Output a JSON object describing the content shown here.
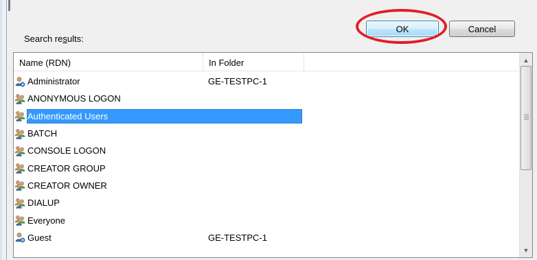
{
  "buttons": {
    "ok_label": "OK",
    "cancel_label": "Cancel"
  },
  "search_label_parts": [
    "Search re",
    "s",
    "ults:"
  ],
  "columns": {
    "name": "Name (RDN)",
    "folder": "In Folder"
  },
  "rows": [
    {
      "name": "Administrator",
      "folder": "GE-TESTPC-1",
      "icon": "user-icon"
    },
    {
      "name": "ANONYMOUS LOGON",
      "folder": "",
      "icon": "group-icon"
    },
    {
      "name": "Authenticated Users",
      "folder": "",
      "icon": "group-icon",
      "selected": true
    },
    {
      "name": "BATCH",
      "folder": "",
      "icon": "group-icon"
    },
    {
      "name": "CONSOLE LOGON",
      "folder": "",
      "icon": "group-icon"
    },
    {
      "name": "CREATOR GROUP",
      "folder": "",
      "icon": "group-icon"
    },
    {
      "name": "CREATOR OWNER",
      "folder": "",
      "icon": "group-icon"
    },
    {
      "name": "DIALUP",
      "folder": "",
      "icon": "group-icon"
    },
    {
      "name": "Everyone",
      "folder": "",
      "icon": "group-icon"
    },
    {
      "name": "Guest",
      "folder": "GE-TESTPC-1",
      "icon": "user-icon"
    }
  ],
  "colors": {
    "selection": "#3399ff",
    "annotation": "#e01f25",
    "ok_border": "#3c7fb1"
  }
}
